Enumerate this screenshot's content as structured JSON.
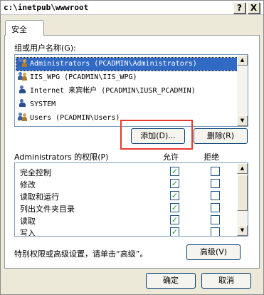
{
  "window": {
    "title": "c:\\inetpub\\wwwroot",
    "help_button": "?",
    "close_button": "X"
  },
  "tab": {
    "label": "安全"
  },
  "groups": {
    "label": "组或用户名称(G):",
    "items": [
      {
        "name": "Administrators (PCADMIN\\Administrators)",
        "selected": true,
        "icon": "group-icon"
      },
      {
        "name": "IIS_WPG (PCADMIN\\IIS_WPG)",
        "selected": false,
        "icon": "group-icon"
      },
      {
        "name": "Internet 来宾帐户 (PCADMIN\\IUSR_PCADMIN)",
        "selected": false,
        "icon": "user-icon"
      },
      {
        "name": "SYSTEM",
        "selected": false,
        "icon": "user-icon"
      },
      {
        "name": "Users (PCADMIN\\Users)",
        "selected": false,
        "icon": "group-icon"
      }
    ]
  },
  "buttons": {
    "add": "添加(D)...",
    "remove": "删除(R)",
    "advanced": "高级(V)",
    "ok": "确定",
    "cancel": "取消"
  },
  "permissions": {
    "label": "Administrators 的权限(P)",
    "allow_header": "允许",
    "deny_header": "拒绝",
    "rows": [
      {
        "name": "完全控制",
        "allow": true,
        "deny": false
      },
      {
        "name": "修改",
        "allow": true,
        "deny": false
      },
      {
        "name": "读取和运行",
        "allow": true,
        "deny": false
      },
      {
        "name": "列出文件夹目录",
        "allow": true,
        "deny": false
      },
      {
        "name": "读取",
        "allow": true,
        "deny": false
      },
      {
        "name": "写入",
        "allow": true,
        "deny": false
      }
    ]
  },
  "special_note": "特别权限或高级设置，请单击“高级”。",
  "colors": {
    "selection": "#316ac5",
    "highlight_box": "#e8392f",
    "check": "#21a121"
  }
}
